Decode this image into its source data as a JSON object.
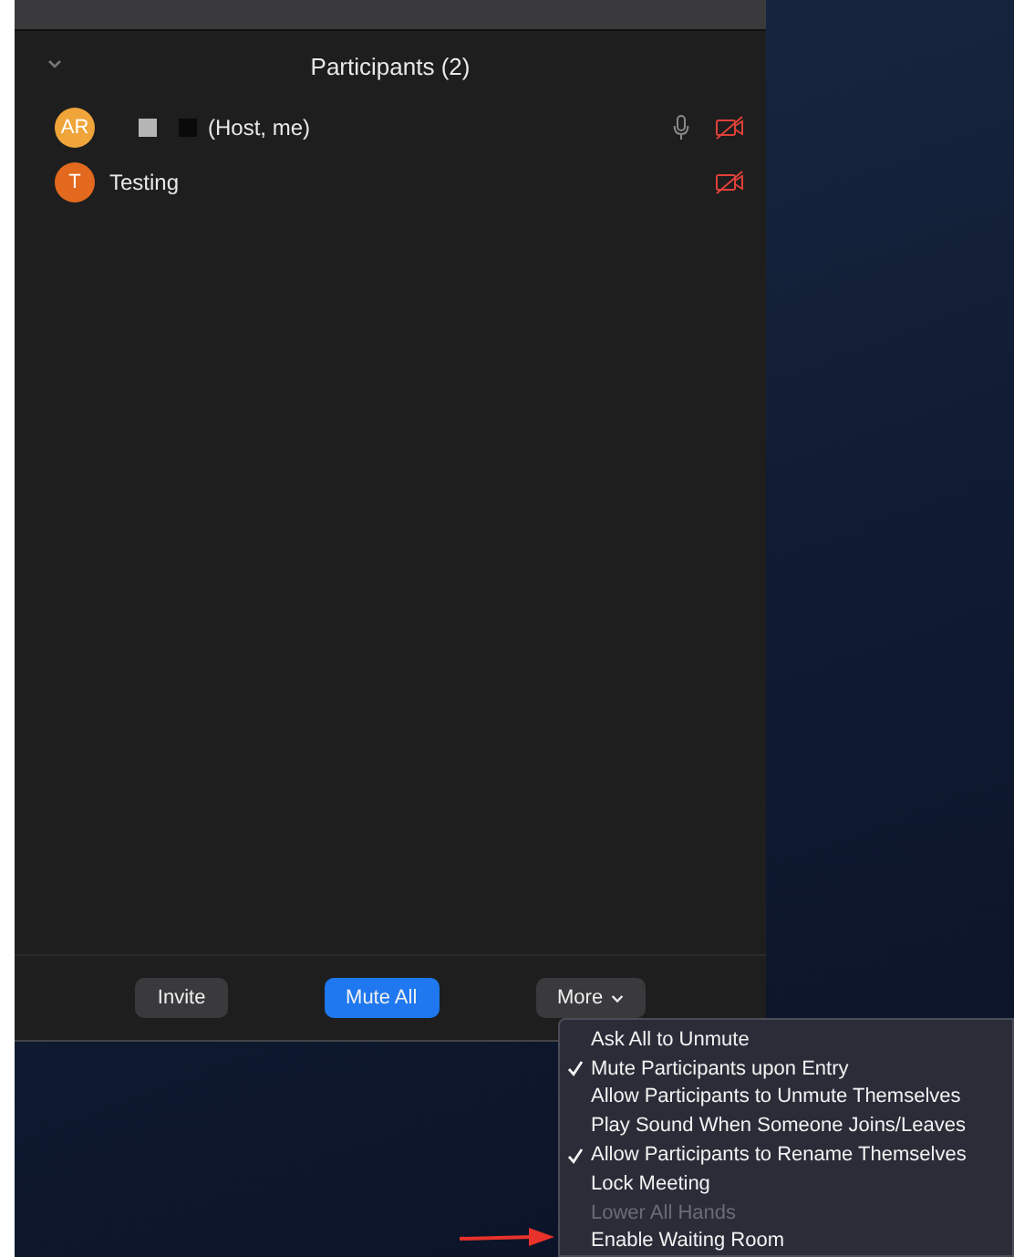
{
  "panel": {
    "title": "Participants (2)"
  },
  "participants": [
    {
      "initials": "AR",
      "color": "#f0a53a",
      "name": "(Host, me)",
      "redacted": true,
      "mic": true,
      "video_off": true
    },
    {
      "initials": "T",
      "color": "#e2691e",
      "name": "Testing",
      "redacted": false,
      "mic": false,
      "video_off": true
    }
  ],
  "buttons": [
    {
      "label": "Invite",
      "kind": "plain"
    },
    {
      "label": "Mute All",
      "kind": "primary"
    },
    {
      "label": "More",
      "kind": "dropdown"
    }
  ],
  "menu": [
    {
      "label": "Ask All to Unmute",
      "checked": false,
      "disabled": false
    },
    {
      "label": "Mute Participants upon Entry",
      "checked": true,
      "disabled": false
    },
    {
      "label": "Allow Participants to Unmute Themselves",
      "checked": false,
      "disabled": false
    },
    {
      "label": "Play Sound When Someone Joins/Leaves",
      "checked": false,
      "disabled": false
    },
    {
      "label": "Allow Participants to Rename Themselves",
      "checked": true,
      "disabled": false
    },
    {
      "label": "Lock Meeting",
      "checked": false,
      "disabled": false
    },
    {
      "label": "Lower All Hands",
      "checked": false,
      "disabled": true
    },
    {
      "label": "Enable Waiting Room",
      "checked": false,
      "disabled": false
    }
  ]
}
